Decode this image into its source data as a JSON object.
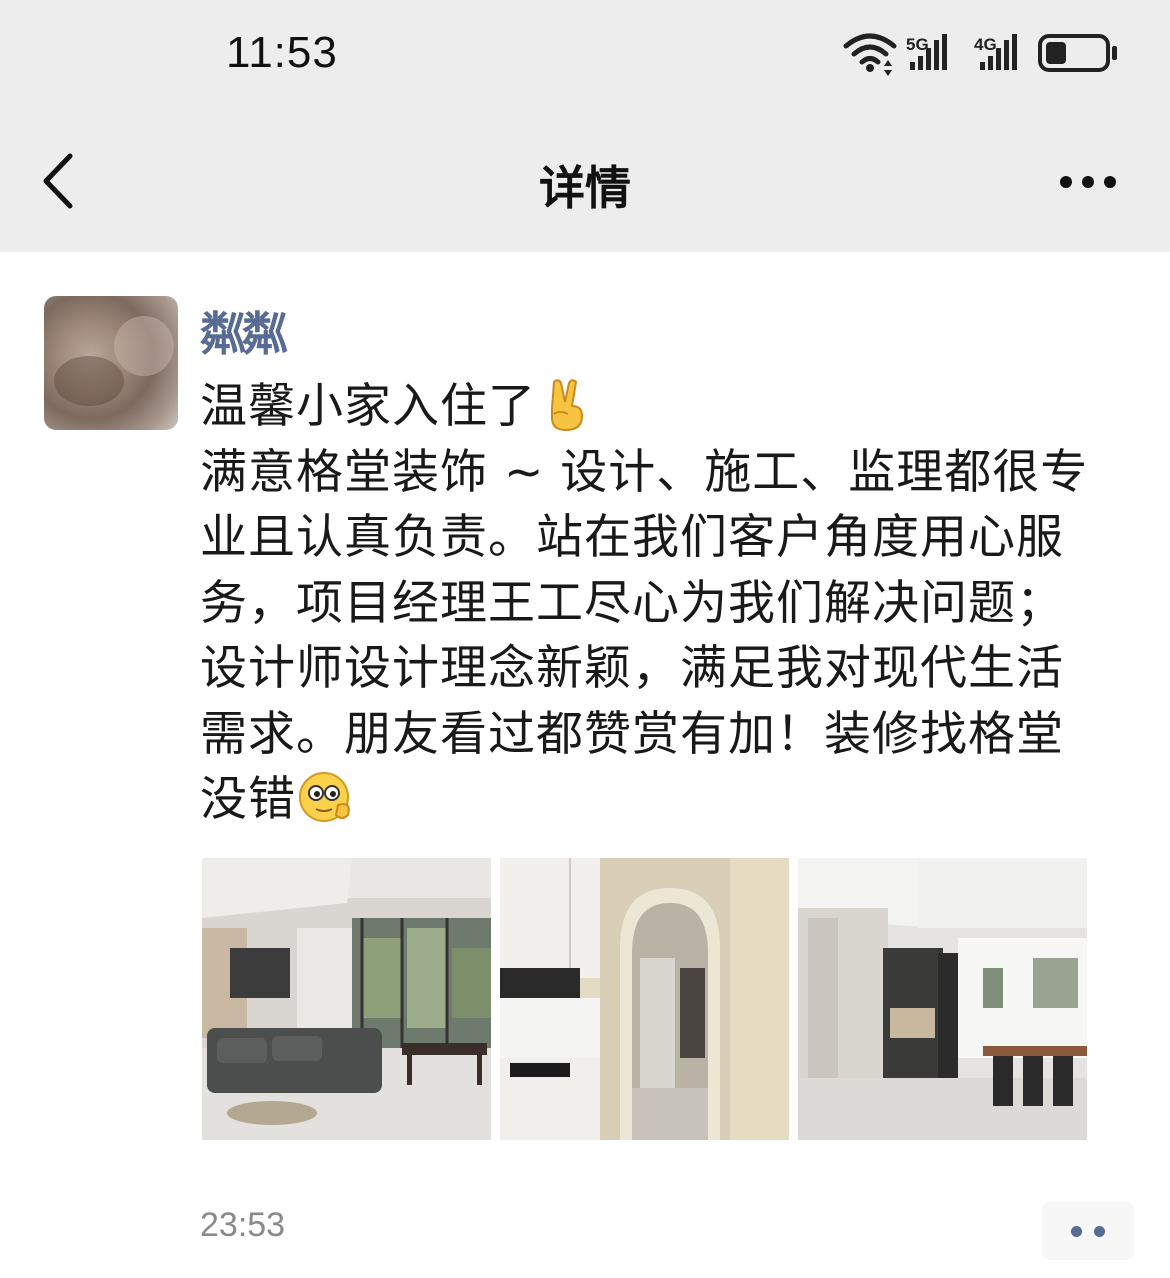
{
  "status_bar": {
    "time": "11:53",
    "network_1": "5G",
    "network_2": "4G",
    "battery_level": 0.35
  },
  "nav": {
    "title": "详情",
    "back_icon": "chevron-left-icon",
    "more_icon": "ellipsis-icon"
  },
  "post": {
    "author": "粼粼",
    "lines": [
      "温馨小家入住了",
      "满意格堂装饰 ~ 设计、施工、监理都很专",
      "业且认真负责。站在我们客户角度用心服",
      "务，项目经理王工尽心为我们解决问题；",
      "设计师设计理念新颖，满足我对现代生活",
      "需求。朋友看过都赞赏有加！装修找格堂",
      "没错"
    ],
    "emoji_1": "victory-hand-emoji",
    "emoji_2": "proud-face-emoji",
    "photos": [
      "living-room-photo",
      "kitchen-hallway-photo",
      "dining-room-photo"
    ],
    "time": "23:53",
    "action_icon": "two-dots-icon"
  },
  "colors": {
    "header_bg": "#ededed",
    "author_link": "#576b95",
    "text": "#191919",
    "muted": "#8a8a8a"
  }
}
